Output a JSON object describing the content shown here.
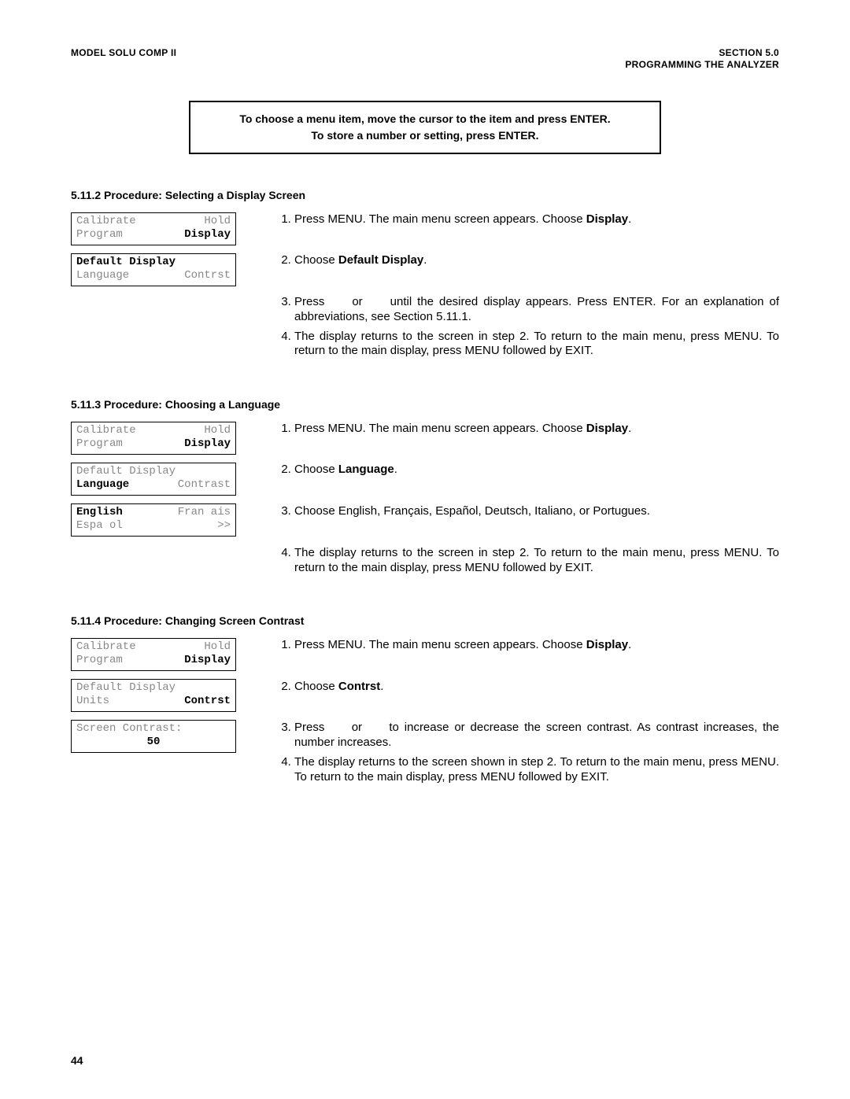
{
  "header": {
    "left": "MODEL SOLU COMP II",
    "right_top": "SECTION 5.0",
    "right_bottom": "PROGRAMMING THE ANALYZER"
  },
  "callout": {
    "line1": "To choose a menu item, move the cursor to the item and press ENTER.",
    "line2": "To store a number or setting, press ENTER."
  },
  "s1": {
    "heading": "5.11.2 Procedure: Selecting a Display Screen",
    "screens": {
      "a": {
        "r1c1": "Calibrate",
        "r1c2": "Hold",
        "r2c1": "Program",
        "r2c2": "Display"
      },
      "b": {
        "r1c1": "Default Display",
        "r1c2": "",
        "r2c1": "Language",
        "r2c2": "Contrst"
      }
    },
    "steps": {
      "s1a": "Press MENU. The main menu screen appears. Choose ",
      "s1b": "Display",
      "s1c": ".",
      "s2a": "Choose ",
      "s2b": "Default Display",
      "s2c": ".",
      "s3": "Press     or     until the desired display appears. Press ENTER. For an explanation of abbreviations, see Section 5.11.1.",
      "s4": "The display returns to the screen in step 2. To return to the main menu, press MENU. To return to the main display, press MENU followed by EXIT."
    }
  },
  "s2": {
    "heading": "5.11.3 Procedure: Choosing a Language",
    "screens": {
      "a": {
        "r1c1": "Calibrate",
        "r1c2": "Hold",
        "r2c1": "Program",
        "r2c2": "Display"
      },
      "b": {
        "r1c1": "Default Display",
        "r1c2": "",
        "r2c1": "Language",
        "r2c2": "Contrast"
      },
      "c": {
        "r1c1": "English",
        "r1c2": "Fran ais",
        "r2c1": "Espa ol",
        "r2c2": ">>"
      }
    },
    "steps": {
      "s1a": "Press MENU. The main menu screen appears. Choose ",
      "s1b": "Display",
      "s1c": ".",
      "s2a": "Choose ",
      "s2b": "Language",
      "s2c": ".",
      "s3": "Choose English, Français, Español, Deutsch, Italiano, or Portugues.",
      "s4": "The display returns to the screen in step 2. To return to the main menu, press MENU. To return to the main display, press MENU followed by EXIT."
    }
  },
  "s3": {
    "heading": "5.11.4 Procedure: Changing Screen Contrast",
    "screens": {
      "a": {
        "r1c1": "Calibrate",
        "r1c2": "Hold",
        "r2c1": "Program",
        "r2c2": "Display"
      },
      "b": {
        "r1c1": "Default Display",
        "r1c2": "",
        "r2c1": "Units",
        "r2c2": "Contrst"
      },
      "c": {
        "r1c1": "Screen Contrast:",
        "r2": "50"
      }
    },
    "steps": {
      "s1a": "Press MENU. The main menu screen appears. Choose ",
      "s1b": "Display",
      "s1c": ".",
      "s2a": "Choose ",
      "s2b": "Contrst",
      "s2c": ".",
      "s3": "Press     or     to increase or decrease the screen contrast. As contrast increases, the number increases.",
      "s4": "The display returns to the screen shown in step 2. To return to the main menu, press MENU. To return to the main display, press MENU followed by EXIT."
    }
  },
  "page_number": "44"
}
